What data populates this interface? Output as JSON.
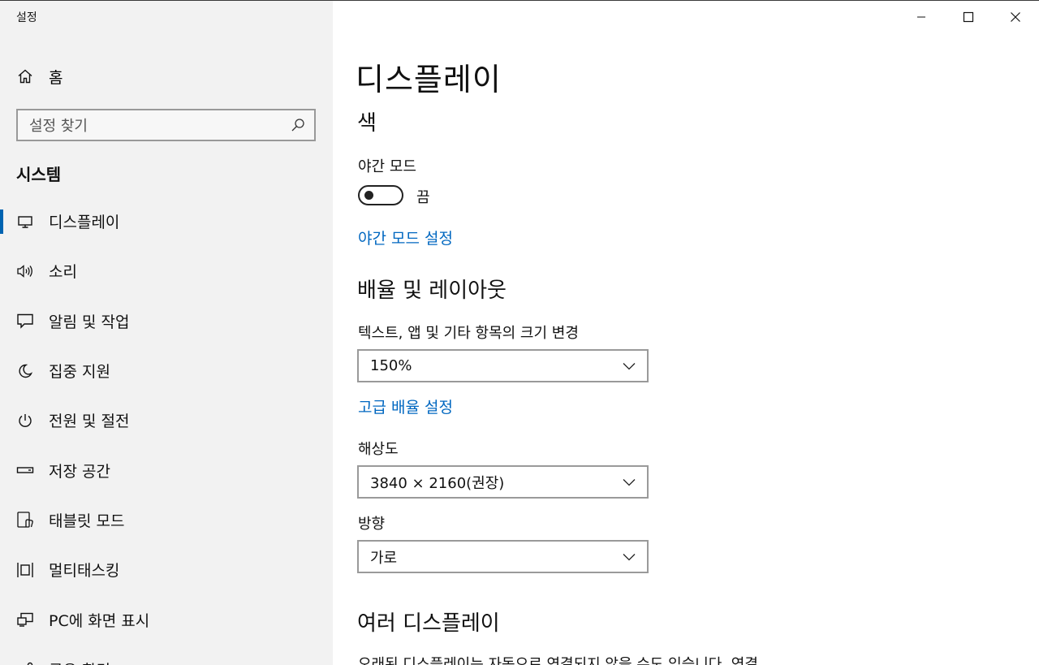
{
  "window": {
    "title": "설정"
  },
  "sidebar": {
    "home_label": "홈",
    "search_placeholder": "설정 찾기",
    "section_title": "시스템",
    "items": [
      {
        "label": "디스플레이",
        "icon": "monitor-icon",
        "active": true
      },
      {
        "label": "소리",
        "icon": "speaker-icon"
      },
      {
        "label": "알림 및 작업",
        "icon": "notification-icon"
      },
      {
        "label": "집중 지원",
        "icon": "moon-icon"
      },
      {
        "label": "전원 및 절전",
        "icon": "power-icon"
      },
      {
        "label": "저장 공간",
        "icon": "storage-icon"
      },
      {
        "label": "태블릿 모드",
        "icon": "tablet-mode-icon"
      },
      {
        "label": "멀티태스킹",
        "icon": "multitasking-icon"
      },
      {
        "label": "PC에 화면 표시",
        "icon": "project-icon"
      },
      {
        "label": "공유 환경",
        "icon": "shared-experiences-icon"
      }
    ]
  },
  "main": {
    "title": "디스플레이",
    "color_section": {
      "heading": "색",
      "night_mode_label": "야간 모드",
      "toggle_state": "끔",
      "toggle_on": false,
      "night_mode_link": "야간 모드 설정"
    },
    "scale_section": {
      "heading": "배율 및 레이아웃",
      "text_size_label": "텍스트, 앱 및 기타 항목의 크기 변경",
      "text_size_value": "150%",
      "advanced_link": "고급 배율 설정",
      "resolution_label": "해상도",
      "resolution_value": "3840 × 2160(권장)",
      "orientation_label": "방향",
      "orientation_value": "가로"
    },
    "multi_section": {
      "heading": "여러 디스플레이",
      "description": "오래된 디스플레이는 자동으로 연결되지 않을 수도 있습니다. 연결"
    }
  },
  "colors": {
    "accent": "#0067c0",
    "sidebar_bg": "#f2f2f2",
    "active_indicator": "#0063b1"
  }
}
